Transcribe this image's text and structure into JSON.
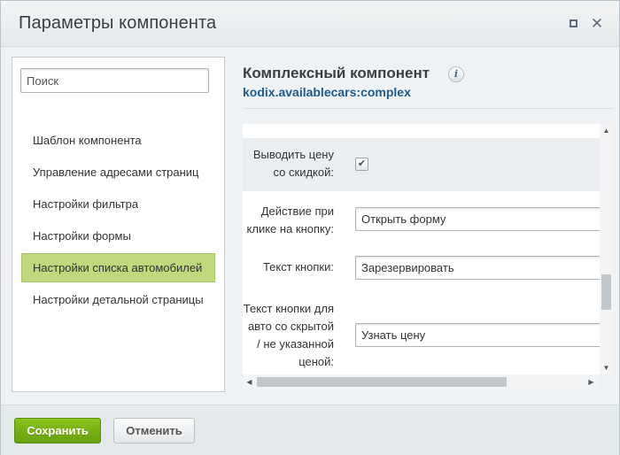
{
  "window": {
    "title": "Параметры компонента",
    "maximize_icon": "maximize-icon",
    "close_icon": "close-icon",
    "close_glyph": "✕"
  },
  "sidebar": {
    "search_placeholder": "Поиск",
    "items": [
      {
        "label": "Шаблон компонента",
        "active": false
      },
      {
        "label": "Управление адресами страниц",
        "active": false
      },
      {
        "label": "Настройки фильтра",
        "active": false
      },
      {
        "label": "Настройки формы",
        "active": false
      },
      {
        "label": "Настройки списка автомобилей",
        "active": true
      },
      {
        "label": "Настройки детальной страницы",
        "active": false
      }
    ]
  },
  "component": {
    "title": "Комплексный компонент",
    "info_icon": "info-icon",
    "info_glyph": "i",
    "code": "kodix.availablecars:complex"
  },
  "params": [
    {
      "label": "Выводить цену со скидкой:",
      "type": "checkbox",
      "checked": true,
      "check_glyph": "✔"
    },
    {
      "label": "Действие при клике на кнопку:",
      "type": "select",
      "value": "Открыть форму"
    },
    {
      "label": "Текст кнопки:",
      "type": "text",
      "value": "Зарезервировать"
    },
    {
      "label": "Текст кнопки для авто со скрытой / не указанной ценой:",
      "type": "text",
      "value": "Узнать цену"
    }
  ],
  "scrollbars": {
    "up_glyph": "▲",
    "down_glyph": "▼",
    "left_glyph": "◀",
    "right_glyph": "▶"
  },
  "footer": {
    "save_label": "Сохранить",
    "cancel_label": "Отменить"
  },
  "colors": {
    "active_item_bg": "#c0d97d",
    "save_button": "#74ad14",
    "component_code": "#1e5a8a"
  }
}
